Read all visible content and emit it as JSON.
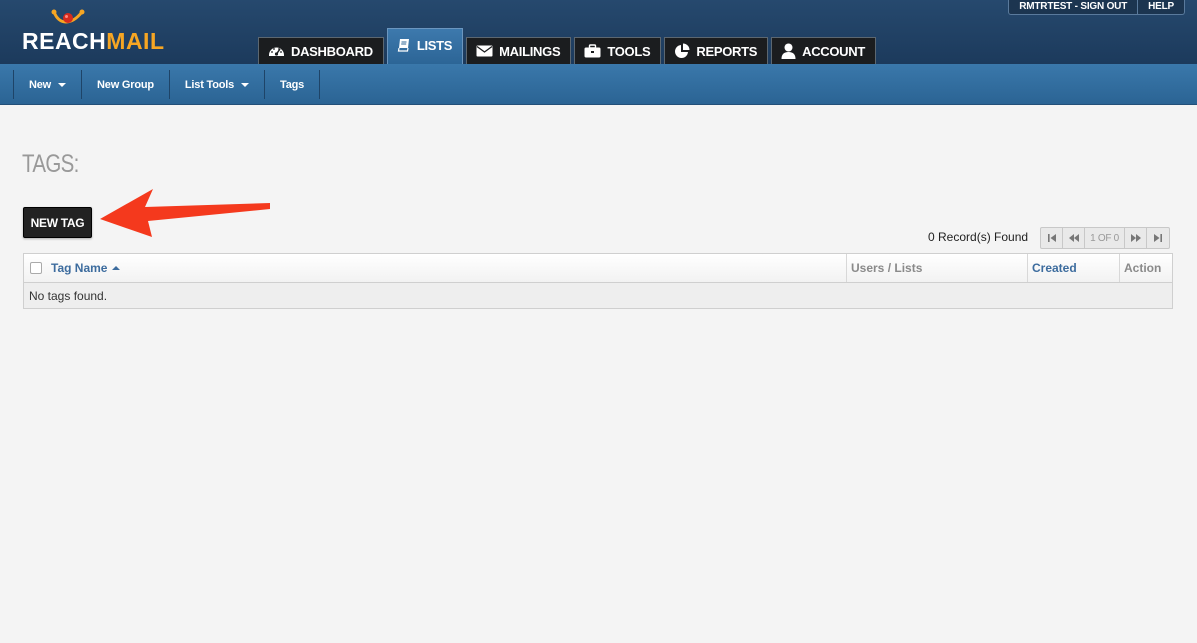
{
  "brand": {
    "reach": "REACH",
    "mail": "MAIL",
    "accent": "#f6a623"
  },
  "utility": {
    "user_link": "RMTRTEST - SIGN OUT",
    "help": "HELP"
  },
  "tabs": [
    {
      "label": "DASHBOARD",
      "icon": "dashboard-icon"
    },
    {
      "label": "LISTS",
      "icon": "book-icon",
      "active": true
    },
    {
      "label": "MAILINGS",
      "icon": "envelope-icon"
    },
    {
      "label": "TOOLS",
      "icon": "briefcase-icon"
    },
    {
      "label": "REPORTS",
      "icon": "pie-chart-icon"
    },
    {
      "label": "ACCOUNT",
      "icon": "user-icon"
    }
  ],
  "subnav": [
    {
      "label": "New",
      "dropdown": true
    },
    {
      "label": "New Group"
    },
    {
      "label": "List Tools",
      "dropdown": true
    },
    {
      "label": "Tags"
    }
  ],
  "page": {
    "title": "TAGS:",
    "new_tag_label": "NEW TAG"
  },
  "pager": {
    "records": "0 Record(s) Found",
    "info": "1 OF 0"
  },
  "grid": {
    "columns": [
      "Tag Name",
      "Users / Lists",
      "Created",
      "Action"
    ],
    "empty": "No tags found."
  },
  "annotation_color": "#f4391d"
}
